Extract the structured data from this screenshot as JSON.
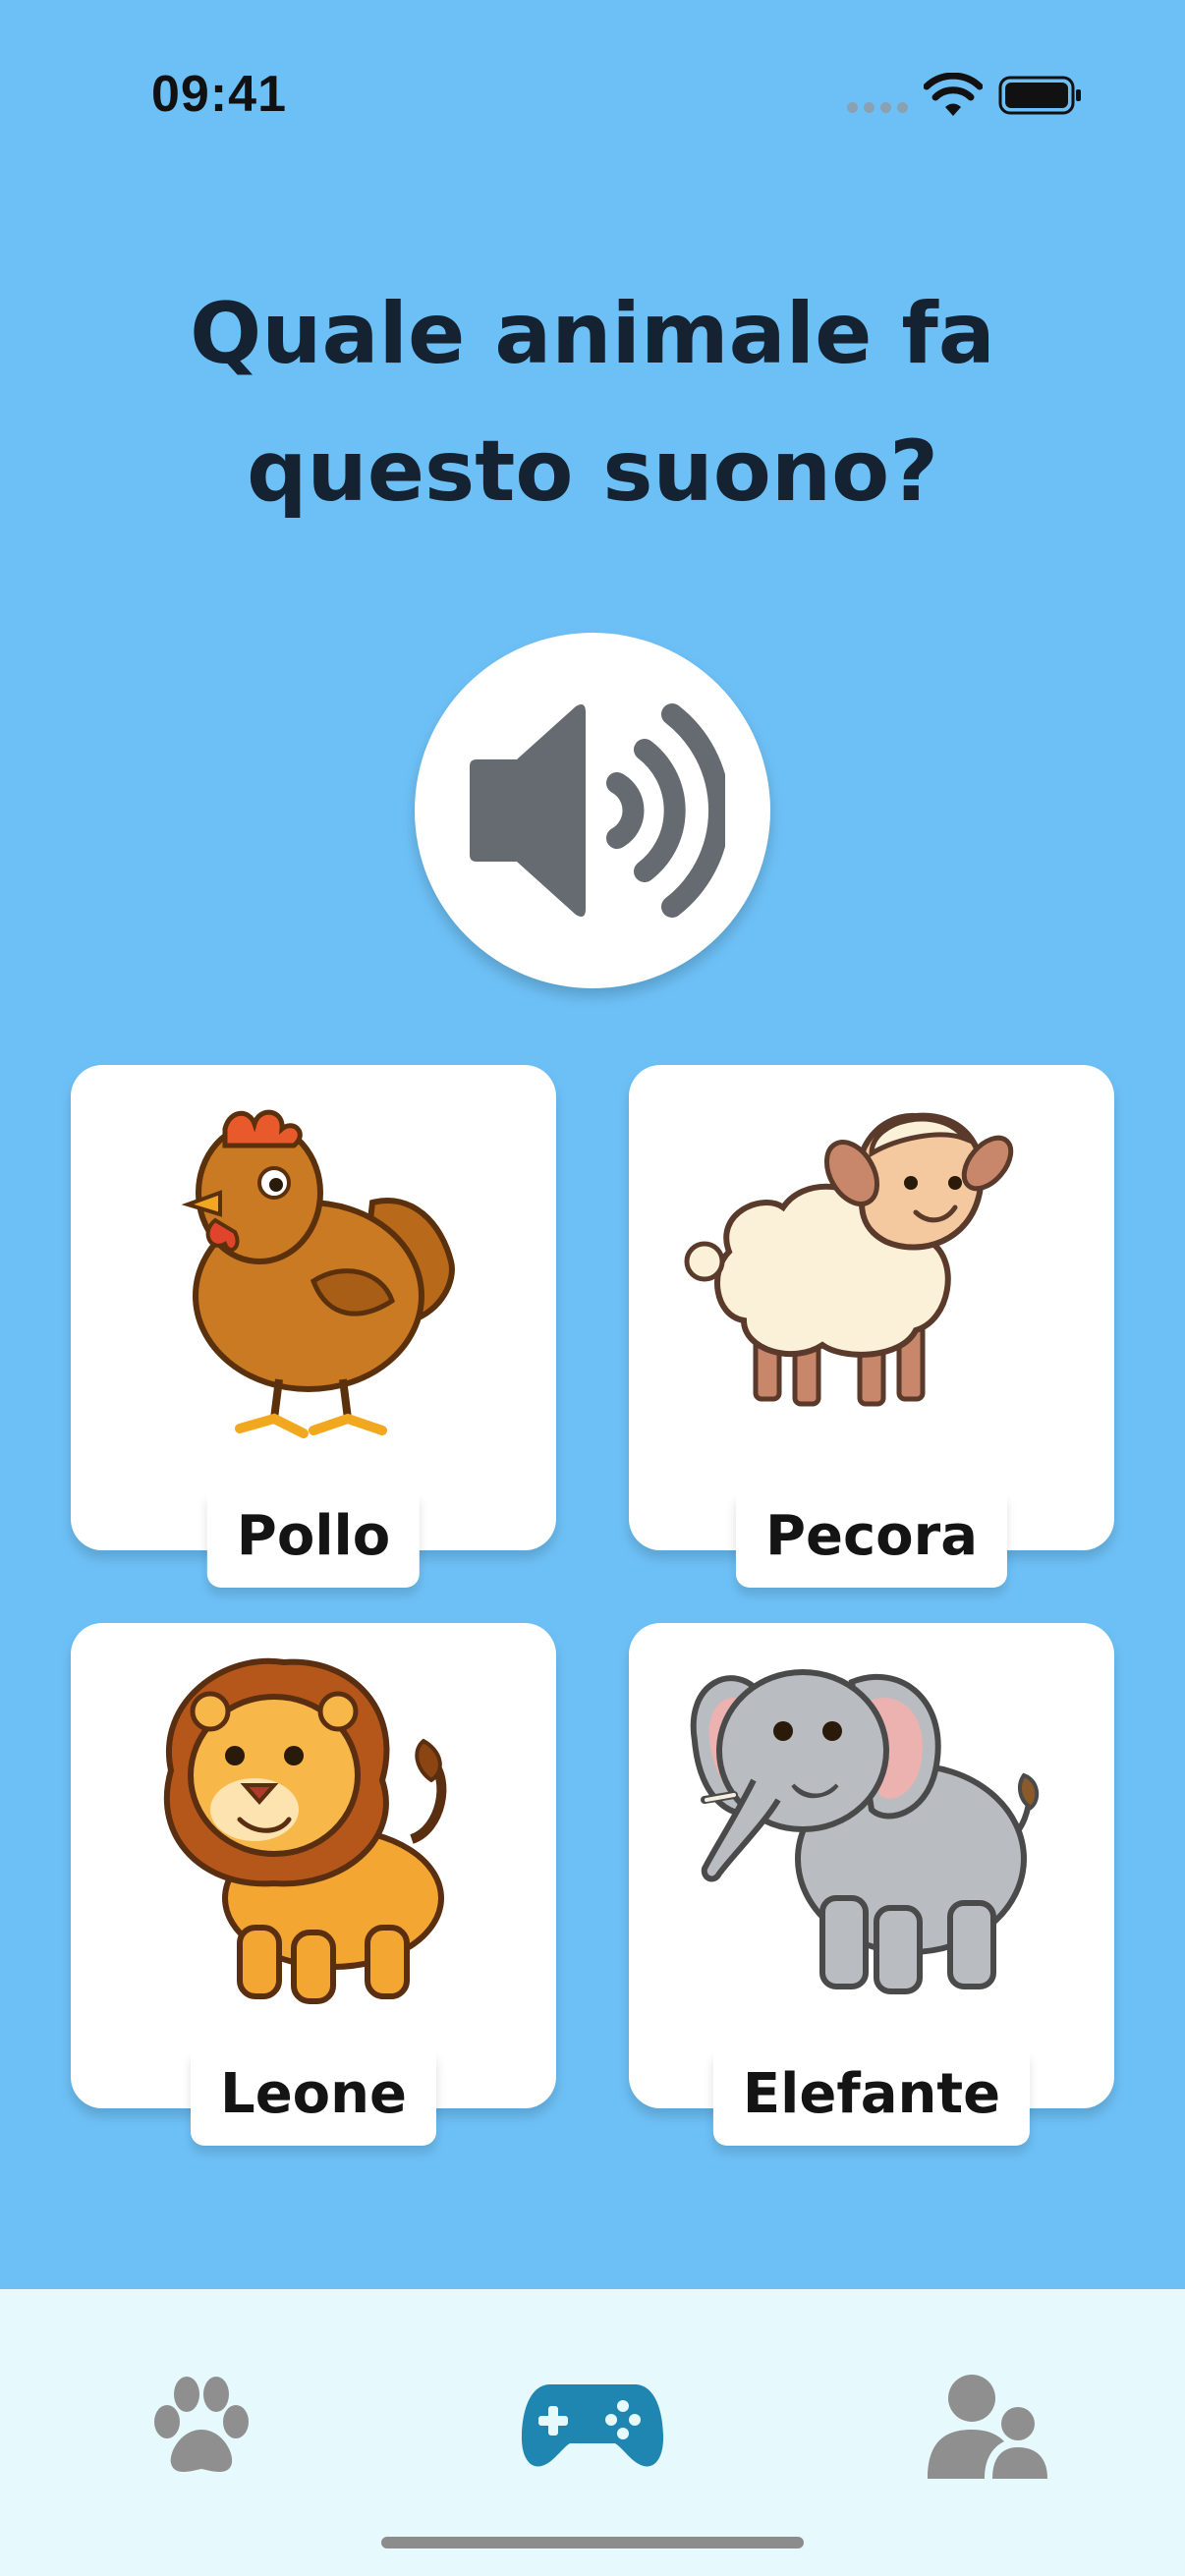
{
  "status_bar": {
    "time": "09:41"
  },
  "question": {
    "text": "Quale animale fa questo suono?"
  },
  "sound_button": {
    "icon": "speaker-volume-icon"
  },
  "cards": [
    {
      "label": "Pollo",
      "icon": "chicken-icon"
    },
    {
      "label": "Pecora",
      "icon": "sheep-icon"
    },
    {
      "label": "Leone",
      "icon": "lion-icon"
    },
    {
      "label": "Elefante",
      "icon": "elephant-icon"
    }
  ],
  "tab_bar": {
    "tabs": [
      {
        "icon": "paw-icon",
        "active": false
      },
      {
        "icon": "gamepad-icon",
        "active": true
      },
      {
        "icon": "users-icon",
        "active": false
      }
    ]
  },
  "colors": {
    "background": "#6DC0F6",
    "tab_bar": "#E6F9FC",
    "active_tab": "#1E86B0",
    "inactive_tab": "#8F8F8F",
    "speaker": "#656B70",
    "title_text": "#152232"
  }
}
